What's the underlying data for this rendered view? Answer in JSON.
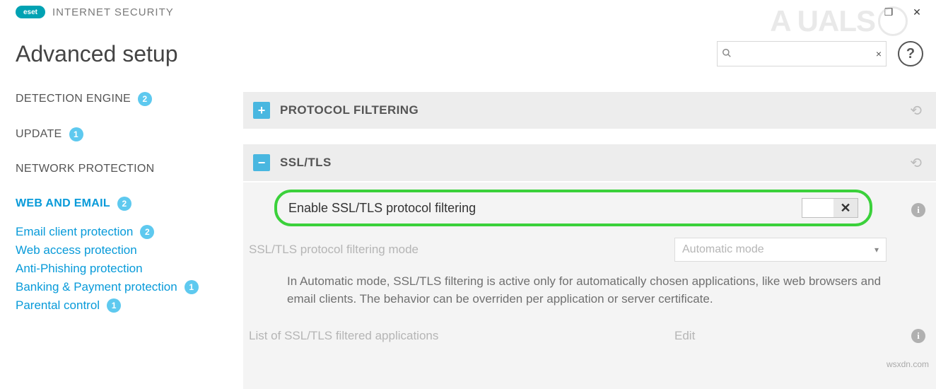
{
  "brand": {
    "logo": "eset",
    "product": "INTERNET SECURITY"
  },
  "page_title": "Advanced setup",
  "search": {
    "placeholder": "",
    "value": "",
    "icon": "search",
    "clear": "×"
  },
  "help_label": "?",
  "window": {
    "maximize": "❐",
    "close": "✕"
  },
  "sidebar": {
    "items": [
      {
        "label": "DETECTION ENGINE",
        "badge": "2",
        "active": false
      },
      {
        "label": "UPDATE",
        "badge": "1",
        "active": false
      },
      {
        "label": "NETWORK PROTECTION",
        "badge": "",
        "active": false
      },
      {
        "label": "WEB AND EMAIL",
        "badge": "2",
        "active": true
      }
    ],
    "subitems": [
      {
        "label": "Email client protection",
        "badge": "2"
      },
      {
        "label": "Web access protection",
        "badge": ""
      },
      {
        "label": "Anti-Phishing protection",
        "badge": ""
      },
      {
        "label": "Banking & Payment protection",
        "badge": "1"
      },
      {
        "label": "Parental control",
        "badge": "1"
      }
    ]
  },
  "sections": {
    "protocol_filtering": {
      "title": "PROTOCOL FILTERING",
      "expanded": false,
      "expander": "+"
    },
    "ssl_tls": {
      "title": "SSL/TLS",
      "expanded": true,
      "expander": "−",
      "enable_row": {
        "label": "Enable SSL/TLS protocol filtering",
        "state_glyph": "✕",
        "value": false
      },
      "mode_row": {
        "label": "SSL/TLS protocol filtering mode",
        "value": "Automatic mode"
      },
      "description": "In Automatic mode, SSL/TLS filtering is active only for automatically chosen applications, like web browsers and email clients. The behavior can be overriden per application or server certificate.",
      "list_row": {
        "label": "List of SSL/TLS filtered applications",
        "action": "Edit"
      }
    }
  },
  "undo_glyph": "⟲",
  "watermark": "A    UALS",
  "source_tag": "wsxdn.com"
}
